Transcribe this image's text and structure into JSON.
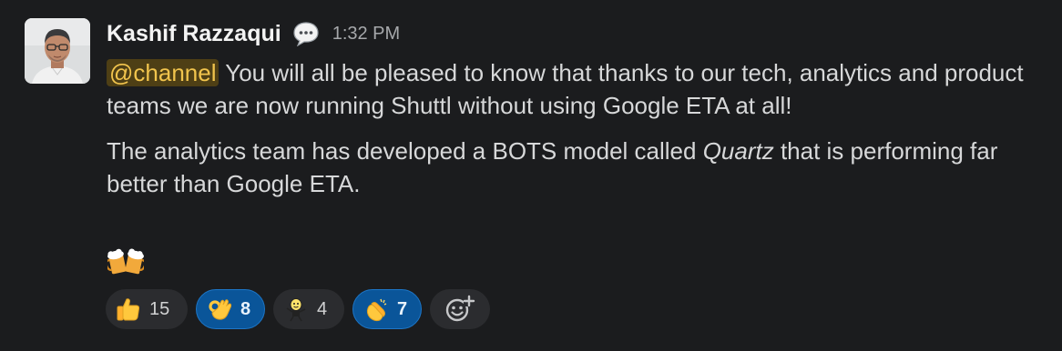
{
  "message": {
    "author": "Kashif Razzaqui",
    "status_icon": "speech-bubble-icon",
    "timestamp": "1:32 PM",
    "mention": "@channel",
    "para1_text": " You will all be pleased to know that thanks to our tech, analytics and product teams we are now running Shuttl without using Google ETA at all!",
    "para2_before": "The analytics team has developed a BOTS model called ",
    "para2_italic": "Quartz",
    "para2_after": " that is performing far better than Google ETA.",
    "trailing_emoji": "beers-icon"
  },
  "reactions": [
    {
      "icon": "thumbs-up-icon",
      "count": "15",
      "active": false
    },
    {
      "icon": "ok-hand-icon",
      "count": "8",
      "active": true
    },
    {
      "icon": "dancing-figure-icon",
      "count": "4",
      "active": false
    },
    {
      "icon": "clapping-hands-icon",
      "count": "7",
      "active": true
    }
  ],
  "add_reaction_icon": "add-reaction-icon",
  "colors": {
    "background": "#1b1c1e",
    "mention_bg": "#4e3f15",
    "mention_text": "#f1c44d",
    "active_reaction_bg": "#0a5599",
    "reaction_bg": "#2b2c2f"
  }
}
